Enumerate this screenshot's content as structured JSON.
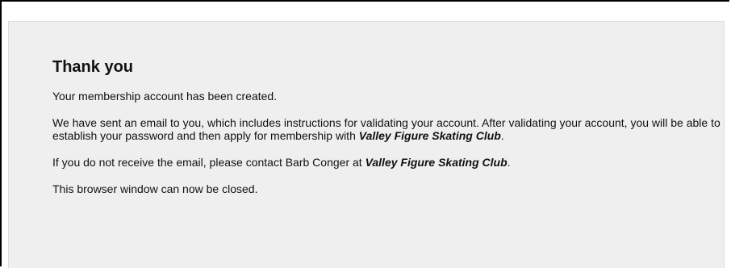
{
  "message": {
    "title": "Thank you",
    "created": "Your membership account has been created.",
    "email_part1": "We have sent an email to you, which includes instructions for validating your account.   After validating your account, you will be able to establish your password and then apply for membership with ",
    "club_name": "Valley Figure Skating Club",
    "email_part2": ".",
    "contact_part1": "If you do not receive the email, please contact Barb Conger at ",
    "contact_part2": ".",
    "close_note": "This browser window can now be closed."
  }
}
